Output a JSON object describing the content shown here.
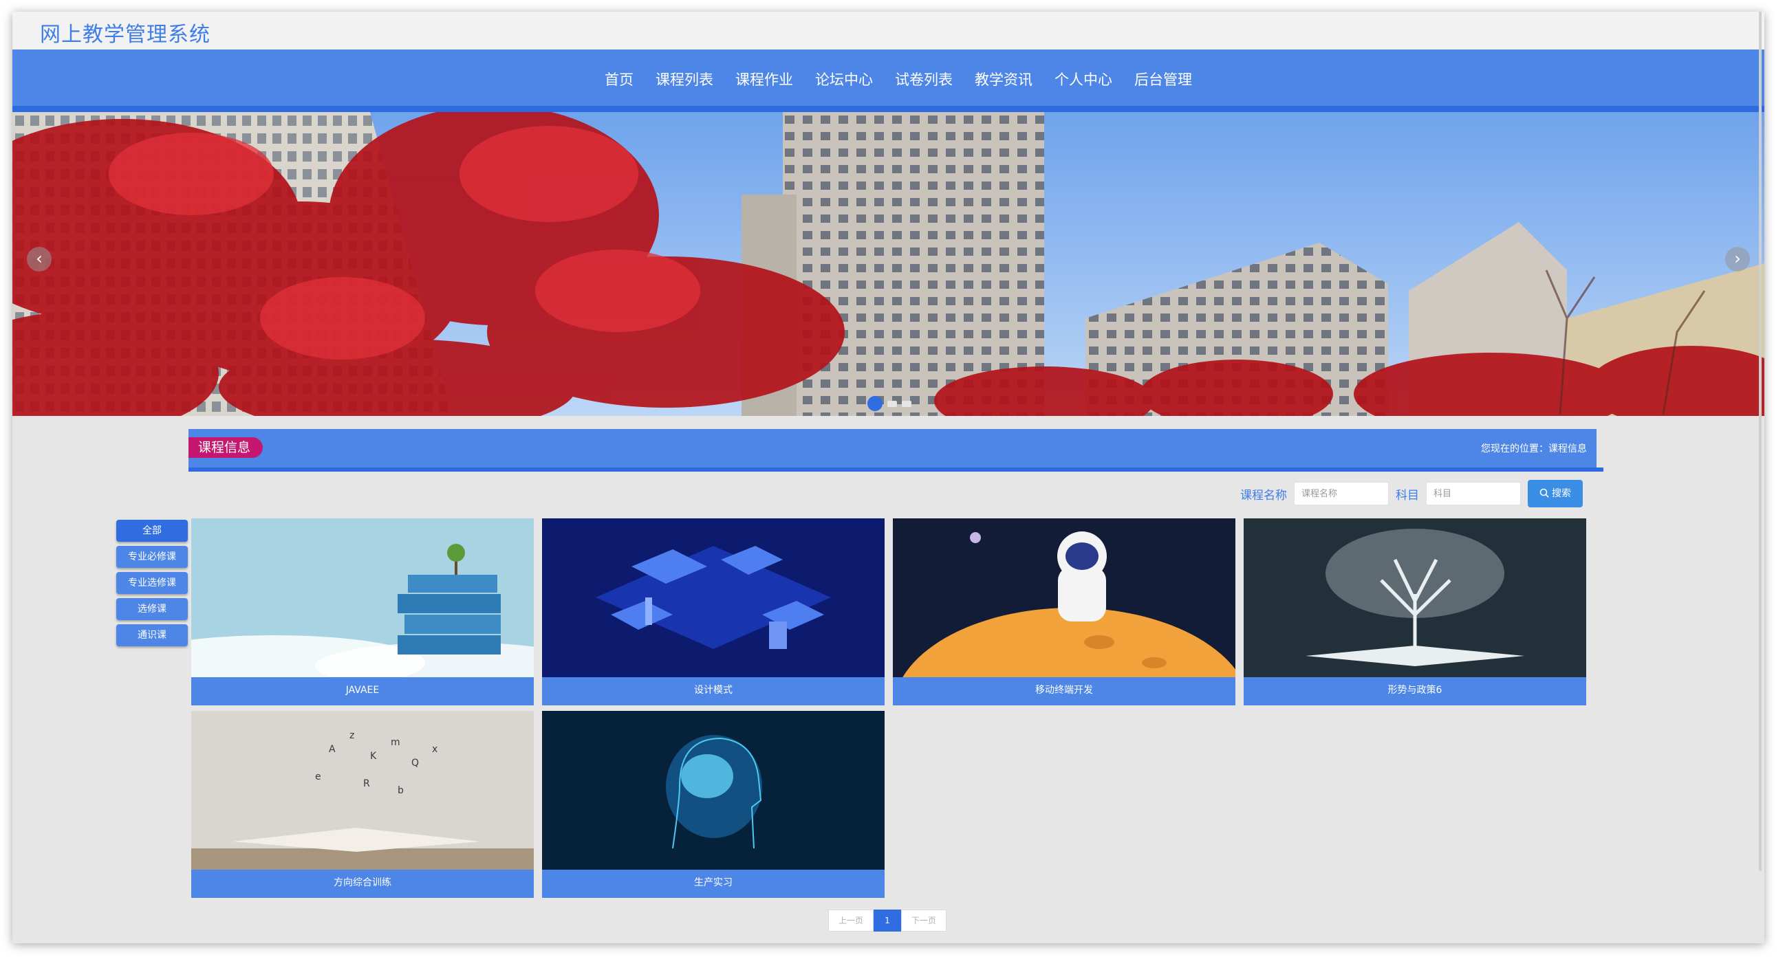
{
  "header": {
    "site_title": "网上教学管理系统"
  },
  "nav": [
    "首页",
    "课程列表",
    "课程作业",
    "论坛中心",
    "试卷列表",
    "教学资讯",
    "个人中心",
    "后台管理"
  ],
  "banner": {
    "prev_icon": "‹",
    "next_icon": "›",
    "slide_count": 3,
    "active_slide": 1
  },
  "section": {
    "tag": "课程信息",
    "breadcrumb": "您现在的位置：课程信息"
  },
  "search": {
    "name_label": "课程名称",
    "name_placeholder": "课程名称",
    "subject_label": "科目",
    "subject_placeholder": "科目",
    "button": "搜索"
  },
  "categories": [
    "全部",
    "专业必修课",
    "专业选修课",
    "选修课",
    "通识课"
  ],
  "courses": [
    "JAVAEE",
    "设计模式",
    "移动终端开发",
    "形势与政策6",
    "方向综合训练",
    "生产实习"
  ],
  "pagination": {
    "prev": "上一页",
    "current": "1",
    "next": "下一页"
  },
  "colors": {
    "primary": "#4d86e6",
    "accent": "#c51670",
    "title": "#3f7de8"
  }
}
